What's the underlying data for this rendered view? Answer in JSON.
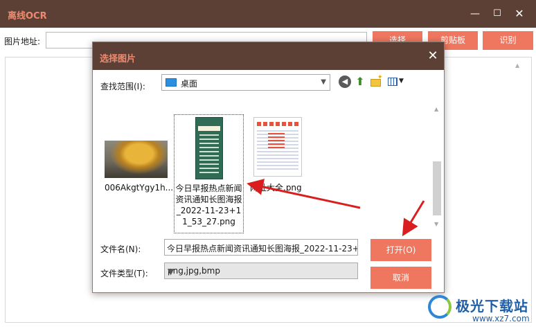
{
  "app": {
    "title": "离线OCR",
    "window_controls": {
      "minimize": "—",
      "maximize": "☐",
      "close": "✕"
    }
  },
  "toolbar": {
    "path_label": "图片地址:",
    "path_value": "",
    "select_button": "选择",
    "clipboard_button": "剪贴板",
    "recognize_button": "识别"
  },
  "dialog": {
    "title": "选择图片",
    "close": "✕",
    "look_in_label": "查找范围(I):",
    "look_in_value": "桌面",
    "nav_icons": [
      "back-icon",
      "up-folder-icon",
      "new-folder-icon",
      "view-menu-icon"
    ],
    "files": [
      {
        "name": "006AkgtYgy1h...",
        "thumbnail": "golden-tree-photo",
        "selected": false
      },
      {
        "name": "今日早报热点新闻资讯通知长图海报_2022-11-23+11_53_27.png",
        "thumbnail": "green-news-poster",
        "selected": true
      },
      {
        "name": "网址大全.png",
        "thumbnail": "web-directory-page",
        "selected": false
      }
    ],
    "filename_label": "文件名(N):",
    "filename_value": "今日早报热点新闻资讯通知长图海报_2022-11-23+",
    "filetype_label": "文件类型(T):",
    "filetype_value": "png,jpg,bmp",
    "open_button": "打开(O)",
    "cancel_button": "取消"
  },
  "watermark": {
    "brand": "极光下载站",
    "url": "www.xz7.com"
  },
  "colors": {
    "titlebar": "#5c4036",
    "accent": "#f0775f",
    "title_text": "#f08a6e",
    "arrow": "#d81e1e"
  }
}
